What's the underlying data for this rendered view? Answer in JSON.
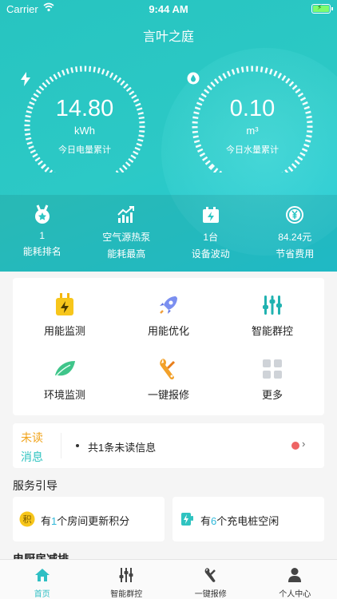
{
  "status_bar": {
    "carrier": "Carrier",
    "time": "9:44 AM"
  },
  "header": {
    "title": "言叶之庭"
  },
  "gauges": [
    {
      "icon": "lightning-icon",
      "value": "14.80",
      "unit": "kWh",
      "label": "今日电量累计"
    },
    {
      "icon": "water-drop-icon",
      "value": "0.10",
      "unit": "m³",
      "label": "今日水量累计"
    }
  ],
  "stats": [
    {
      "icon": "medal-icon",
      "value": "1",
      "label": "能耗排名"
    },
    {
      "icon": "trend-chart-icon",
      "value": "空气源热泵",
      "label": "能耗最高"
    },
    {
      "icon": "device-bolt-icon",
      "value": "1台",
      "label": "设备波动"
    },
    {
      "icon": "yen-coin-icon",
      "value": "84.24元",
      "label": "节省费用"
    }
  ],
  "grid": [
    {
      "icon": "plug-icon",
      "label": "用能监测"
    },
    {
      "icon": "rocket-icon",
      "label": "用能优化"
    },
    {
      "icon": "sliders-icon",
      "label": "智能群控"
    },
    {
      "icon": "leaf-icon",
      "label": "环境监测"
    },
    {
      "icon": "wrench-icon",
      "label": "一键报修"
    },
    {
      "icon": "more-grid-icon",
      "label": "更多"
    }
  ],
  "notice": {
    "tag_line1": "未读",
    "tag_line2": "消息",
    "message": "共1条未读信息"
  },
  "service": {
    "title": "服务引导",
    "cards": [
      {
        "prefix": "有",
        "number": "1",
        "suffix": "个房间更新积分",
        "icon": "points-icon"
      },
      {
        "prefix": "有",
        "number": "6",
        "suffix": "个充电桩空闲",
        "icon": "charger-icon"
      }
    ]
  },
  "section2": {
    "title": "电厨房减排"
  },
  "tabbar": [
    {
      "icon": "home-icon",
      "label": "首页",
      "active": true
    },
    {
      "icon": "sliders-icon",
      "label": "智能群控",
      "active": false
    },
    {
      "icon": "wrench-icon",
      "label": "一键报修",
      "active": false
    },
    {
      "icon": "user-icon",
      "label": "个人中心",
      "active": false
    }
  ],
  "colors": {
    "primary": "#2cc6c4",
    "warning": "#f1a41c",
    "accent": "#2fbfc4",
    "badge": "#ee6464"
  }
}
